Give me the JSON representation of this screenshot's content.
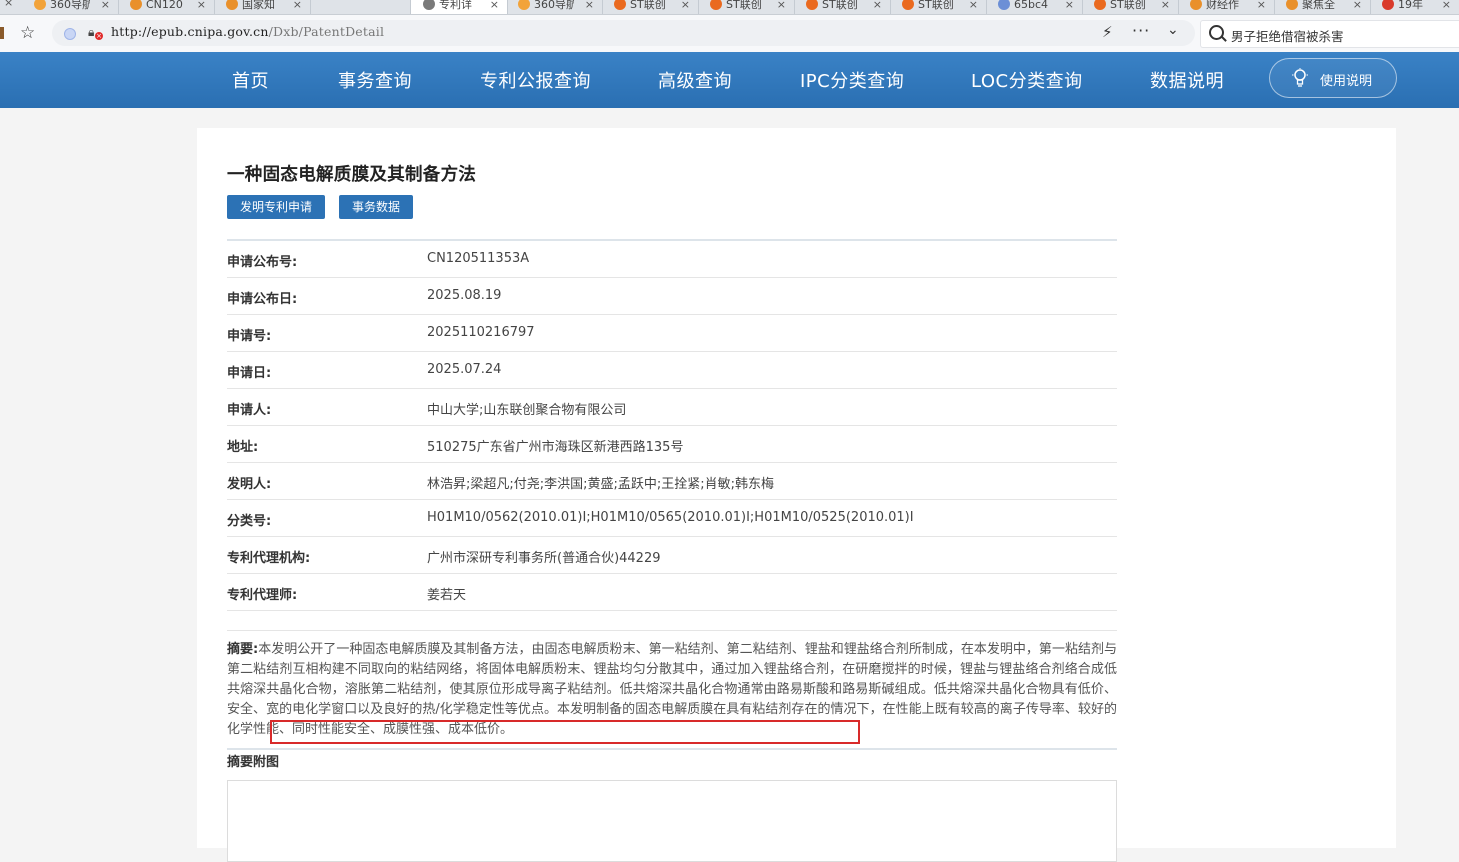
{
  "browser": {
    "tabs": [
      {
        "label": "360导航",
        "icon_color": "#f2a33a"
      },
      {
        "label": "CN120",
        "icon_color": "#e9902b"
      },
      {
        "label": "国家知",
        "icon_color": "#e9902b"
      },
      {
        "label": "专利详",
        "icon_color": "#7a7a7a",
        "active": true
      },
      {
        "label": "360导航",
        "icon_color": "#f2a33a"
      },
      {
        "label": "ST联创",
        "icon_color": "#ea6a1f"
      },
      {
        "label": "ST联创",
        "icon_color": "#ea6a1f"
      },
      {
        "label": "ST联创",
        "icon_color": "#ea6a1f"
      },
      {
        "label": "ST联创",
        "icon_color": "#ea6a1f"
      },
      {
        "label": "65bc4",
        "icon_color": "#6c8fd6"
      },
      {
        "label": "ST联创",
        "icon_color": "#ea6a1f"
      },
      {
        "label": "财经作",
        "icon_color": "#e9902b"
      },
      {
        "label": "聚焦全",
        "icon_color": "#e9902b"
      },
      {
        "label": "19年",
        "icon_color": "#d93a2b"
      }
    ],
    "tab_close": "×",
    "url_host": "http://epub.cnipa.gov.cn",
    "url_path": "/Dxb/PatentDetail",
    "search_text": "男子拒绝借宿被杀害",
    "more_glyph": "···"
  },
  "nav": {
    "items": [
      "首页",
      "事务查询",
      "专利公报查询",
      "高级查询",
      "IPC分类查询",
      "LOC分类查询",
      "数据说明"
    ],
    "help_label": "使用说明"
  },
  "patent": {
    "title": "一种固态电解质膜及其制备方法",
    "buttons": [
      "发明专利申请",
      "事务数据"
    ],
    "fields": [
      {
        "label": "申请公布号:",
        "value": "CN120511353A"
      },
      {
        "label": "申请公布日:",
        "value": "2025.08.19"
      },
      {
        "label": "申请号:",
        "value": "2025110216797"
      },
      {
        "label": "申请日:",
        "value": "2025.07.24"
      },
      {
        "label": "申请人:",
        "value": "中山大学;山东联创聚合物有限公司"
      },
      {
        "label": "地址:",
        "value": "510275广东省广州市海珠区新港西路135号"
      },
      {
        "label": "发明人:",
        "value": "林浩昇;梁超凡;付尧;李洪国;黄盛;孟跃中;王拴紧;肖敏;韩东梅"
      },
      {
        "label": "分类号:",
        "value": "H01M10/0562(2010.01)I;H01M10/0565(2010.01)I;H01M10/0525(2010.01)I"
      },
      {
        "label": "专利代理机构:",
        "value": "广州市深研专利事务所(普通合伙)44229"
      },
      {
        "label": "专利代理师:",
        "value": "姜若天"
      }
    ],
    "abstract_label": "摘要:",
    "abstract_text": "本发明公开了一种固态电解质膜及其制备方法，由固态电解质粉末、第一粘结剂、第二粘结剂、锂盐和锂盐络合剂所制成，在本发明中，第一粘结剂与第二粘结剂互相构建不同取向的粘结网络，将固体电解质粉末、锂盐均匀分散其中，通过加入锂盐络合剂，在研磨搅拌的时候，锂盐与锂盐络合剂络合成低共熔深共晶化合物，溶胀第二粘结剂，使其原位形成导离子粘结剂。低共熔深共晶化合物通常由路易斯酸和路易斯碱组成。低共熔深共晶化合物具有低价、安全、宽的电化学窗口以及良好的热/化学稳定性等优点。本发明制备的固态电解质膜在具有粘结剂存在的情况下，在性能上既有较高的离子传导率、较好的化学性能、同时性能安全、成膜性强、成本低价。",
    "figure_label": "摘要附图"
  }
}
